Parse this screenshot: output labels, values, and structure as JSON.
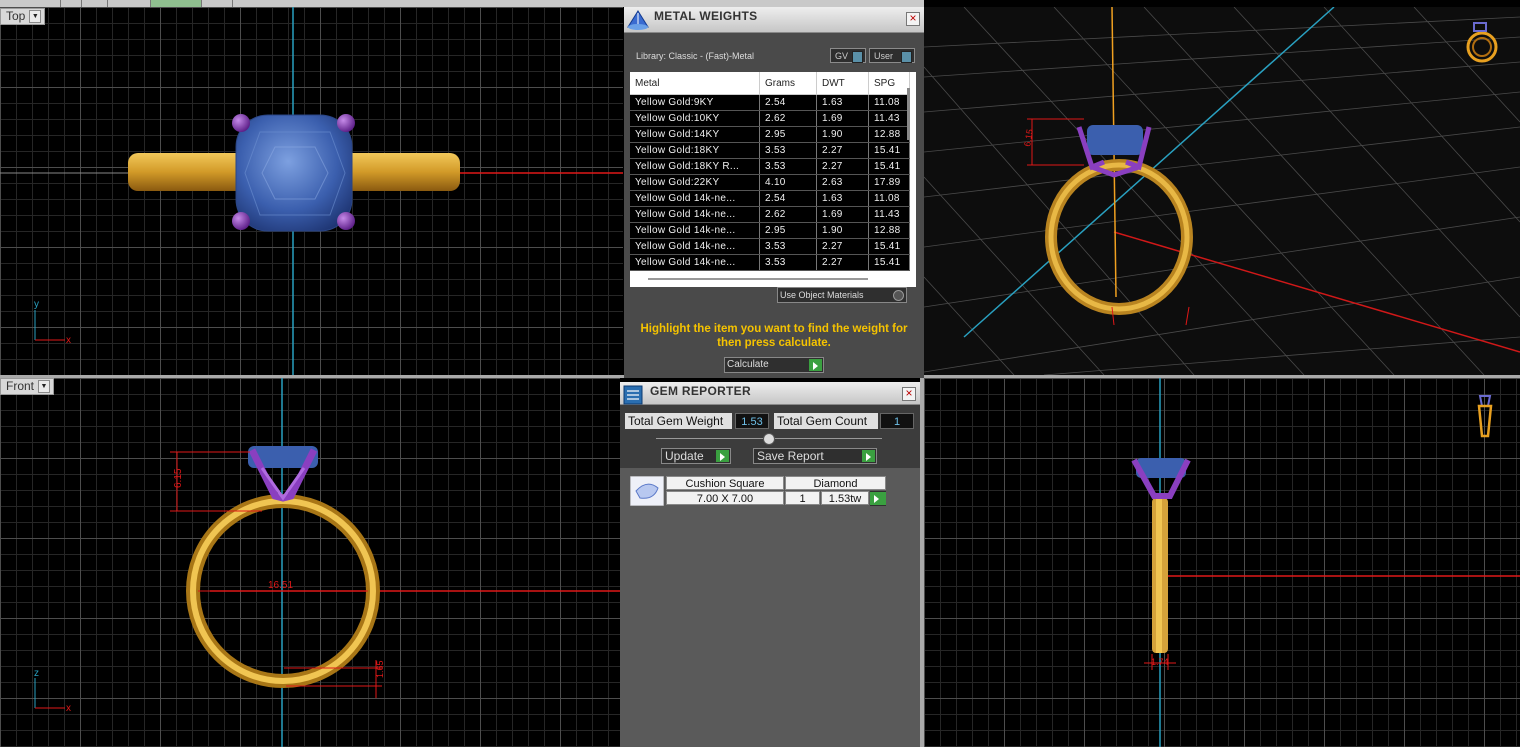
{
  "viewports": {
    "top": {
      "label": "Top"
    },
    "front": {
      "label": "Front"
    },
    "dimensions": {
      "front_height": "6.15",
      "front_diameter": "16.51",
      "front_band": "1.65",
      "side_band": "1.74",
      "persp_height": "6.15"
    }
  },
  "metal_weights": {
    "title": "METAL WEIGHTS",
    "library": "Library: Classic - (Fast)-Metal",
    "gv_label": "GV",
    "user_label": "User",
    "columns": [
      "Metal",
      "Grams",
      "DWT",
      "SPG"
    ],
    "rows": [
      [
        "Yellow Gold:9KY",
        "2.54",
        "1.63",
        "11.08"
      ],
      [
        "Yellow Gold:10KY",
        "2.62",
        "1.69",
        "11.43"
      ],
      [
        "Yellow Gold:14KY",
        "2.95",
        "1.90",
        "12.88"
      ],
      [
        "Yellow Gold:18KY",
        "3.53",
        "2.27",
        "15.41"
      ],
      [
        "Yellow Gold:18KY R...",
        "3.53",
        "2.27",
        "15.41"
      ],
      [
        "Yellow Gold:22KY",
        "4.10",
        "2.63",
        "17.89"
      ],
      [
        "Yellow Gold 14k-ne...",
        "2.54",
        "1.63",
        "11.08"
      ],
      [
        "Yellow Gold 14k-ne...",
        "2.62",
        "1.69",
        "11.43"
      ],
      [
        "Yellow Gold 14k-ne...",
        "2.95",
        "1.90",
        "12.88"
      ],
      [
        "Yellow Gold 14k-ne...",
        "3.53",
        "2.27",
        "15.41"
      ],
      [
        "Yellow Gold 14k-ne...",
        "3.53",
        "2.27",
        "15.41"
      ]
    ],
    "use_object_materials": "Use Object Materials",
    "hint": "Highlight the item you want to find the weight for then press calculate.",
    "calculate": "Calculate"
  },
  "gem_reporter": {
    "title": "GEM REPORTER",
    "total_weight_label": "Total Gem Weight",
    "total_weight": "1.53",
    "total_count_label": "Total Gem Count",
    "total_count": "1",
    "update": "Update",
    "save_report": "Save Report",
    "gem": {
      "shape": "Cushion Square",
      "material": "Diamond",
      "size": "7.00 X 7.00",
      "qty": "1",
      "weight": "1.53tw"
    }
  },
  "colors": {
    "gold": "#d4a23a",
    "gem": "#3b5fae",
    "prongs": "#7a3aa8",
    "dimension": "#e01818",
    "axis_cyan": "#29a0c0",
    "hint": "#f5c300"
  }
}
